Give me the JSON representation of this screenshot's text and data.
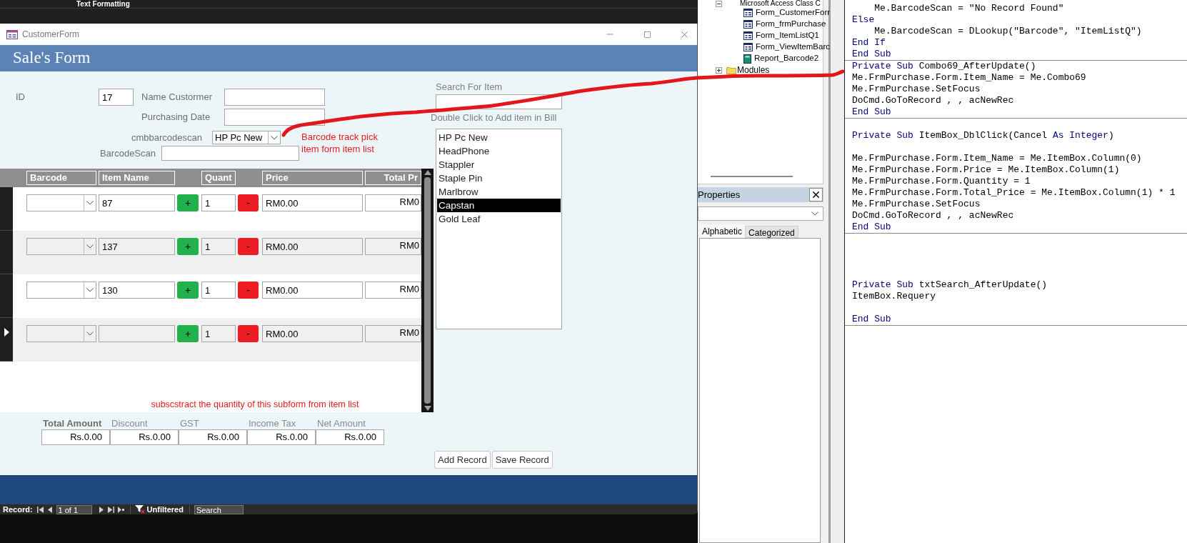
{
  "background": {
    "toolbar_label": "Text Formatting"
  },
  "form": {
    "title": "CustomerForm",
    "heading": "Sale's Form",
    "id": {
      "label": "ID",
      "value": "17"
    },
    "name_customer": {
      "label": "Name Custormer"
    },
    "purchasing_date": {
      "label": "Purchasing Date"
    },
    "barcode_combo": {
      "label": "cmbbarcodescan",
      "value": "HP Pc New"
    },
    "barcode_scan": {
      "label": "BarcodeScan"
    },
    "note_barcode": [
      "Barcode track pick",
      "item form item list"
    ],
    "search": {
      "label": "Search For Item"
    },
    "item_list": {
      "label": "Double Click to Add item in Bill",
      "items": [
        {
          "text": "HP Pc New",
          "selected": false
        },
        {
          "text": "HeadPhone",
          "selected": false
        },
        {
          "text": "Stappler",
          "selected": false
        },
        {
          "text": "Staple Pin",
          "selected": false
        },
        {
          "text": "Marlbrow",
          "selected": false
        },
        {
          "text": "Capstan",
          "selected": true
        },
        {
          "text": "Gold Leaf",
          "selected": false
        }
      ]
    },
    "subform": {
      "columns": [
        "Barcode",
        "Item Name",
        "Quant",
        "Price",
        "Total Pr"
      ],
      "rows": [
        {
          "item_name": "87",
          "add": "+",
          "quantity": "1",
          "remove": "-",
          "price": "RM0.00",
          "total": "RM0",
          "current": false
        },
        {
          "item_name": "137",
          "add": "+",
          "quantity": "1",
          "remove": "-",
          "price": "RM0.00",
          "total": "RM0",
          "current": false
        },
        {
          "item_name": "130",
          "add": "+",
          "quantity": "1",
          "remove": "-",
          "price": "RM0.00",
          "total": "RM0",
          "current": false
        },
        {
          "add": "+",
          "quantity": "1",
          "remove": "-",
          "price": "RM0.00",
          "total": "RM0",
          "current": true
        }
      ],
      "note": "subscstract the quantity of this subform from item list"
    },
    "totals": [
      {
        "label": "Total Amount",
        "value": "Rs.0.00"
      },
      {
        "label": "Discount",
        "value": "Rs.0.00"
      },
      {
        "label": "GST",
        "value": "Rs.0.00"
      },
      {
        "label": "Income Tax",
        "value": "Rs.0.00"
      },
      {
        "label": "Net Amount",
        "value": "Rs.0.00"
      }
    ],
    "buttons": [
      "Add Record",
      "Save Record"
    ],
    "navigation": {
      "label": "Record:",
      "position": "1 of 1",
      "filter": "Unfiltered",
      "search": "Search"
    }
  },
  "project_tree": {
    "items": [
      {
        "name": "Microsoft Access Class C",
        "expanded": true,
        "children": [
          {
            "name": "Form_CustomerForr",
            "kind": "form"
          },
          {
            "name": "Form_frmPurchase",
            "kind": "form"
          },
          {
            "name": "Form_ItemListQ1",
            "kind": "form"
          },
          {
            "name": "Form_ViewItemBarc",
            "kind": "form"
          },
          {
            "name": "Report_Barcode2",
            "kind": "report"
          }
        ]
      },
      {
        "name": "Modules",
        "expanded": false
      }
    ]
  },
  "properties": {
    "title": "Properties",
    "tabs": [
      {
        "label": "Alphabetic",
        "selected": true
      },
      {
        "label": "Categorized",
        "selected": false
      }
    ]
  },
  "code": {
    "procedures": [
      {
        "lines": [
          {
            "kind": "code",
            "tokens": [
              {
                "text": "    Me.BarcodeScan = \"No Record Found\"",
                "keyword": false
              }
            ]
          },
          {
            "kind": "code",
            "tokens": [
              {
                "text": "Else",
                "keyword": true
              }
            ]
          },
          {
            "kind": "code",
            "tokens": [
              {
                "text": "    Me.BarcodeScan = DLookup(\"Barcode\", \"ItemListQ\")",
                "keyword": false
              }
            ]
          },
          {
            "kind": "code",
            "tokens": [
              {
                "text": "End If",
                "keyword": true
              }
            ]
          },
          {
            "kind": "code",
            "tokens": [
              {
                "text": "End Sub",
                "keyword": true
              }
            ]
          }
        ]
      },
      {
        "lines": [
          {
            "kind": "code",
            "tokens": [
              {
                "text": "Private Sub",
                "keyword": true
              },
              {
                "text": " Combo69_AfterUpdate()",
                "keyword": false
              }
            ]
          },
          {
            "kind": "code",
            "tokens": [
              {
                "text": "Me.FrmPurchase.Form.Item_Name = Me.Combo69",
                "keyword": false
              }
            ]
          },
          {
            "kind": "code",
            "tokens": [
              {
                "text": "Me.FrmPurchase.SetFocus",
                "keyword": false
              }
            ]
          },
          {
            "kind": "code",
            "tokens": [
              {
                "text": "DoCmd.GoToRecord , , acNewRec",
                "keyword": false
              }
            ]
          },
          {
            "kind": "code",
            "tokens": [
              {
                "text": "End Sub",
                "keyword": true
              }
            ]
          }
        ]
      },
      {
        "lines": [
          {
            "kind": "blank"
          },
          {
            "kind": "code",
            "tokens": [
              {
                "text": "Private Sub",
                "keyword": true
              },
              {
                "text": " ItemBox_DblClick(Cancel ",
                "keyword": false
              },
              {
                "text": "As Integer",
                "keyword": true
              },
              {
                "text": ")",
                "keyword": false
              }
            ]
          },
          {
            "kind": "blank"
          },
          {
            "kind": "code",
            "tokens": [
              {
                "text": "Me.FrmPurchase.Form.Item_Name = Me.ItemBox.Column(0)",
                "keyword": false
              }
            ]
          },
          {
            "kind": "code",
            "tokens": [
              {
                "text": "Me.FrmPurchase.Form.Price = Me.ItemBox.Column(1)",
                "keyword": false
              }
            ]
          },
          {
            "kind": "code",
            "tokens": [
              {
                "text": "Me.FrmPurchase.Form.Quantity = 1",
                "keyword": false
              }
            ]
          },
          {
            "kind": "code",
            "tokens": [
              {
                "text": "Me.FrmPurchase.Form.Total_Price = Me.ItemBox.Column(1) * 1",
                "keyword": false
              }
            ]
          },
          {
            "kind": "code",
            "tokens": [
              {
                "text": "Me.FrmPurchase.SetFocus",
                "keyword": false
              }
            ]
          },
          {
            "kind": "code",
            "tokens": [
              {
                "text": "DoCmd.GoToRecord , , acNewRec",
                "keyword": false
              }
            ]
          },
          {
            "kind": "code",
            "tokens": [
              {
                "text": "End Sub",
                "keyword": true
              }
            ]
          }
        ]
      },
      {
        "lines": [
          {
            "kind": "blank"
          },
          {
            "kind": "blank"
          },
          {
            "kind": "blank"
          },
          {
            "kind": "blank"
          },
          {
            "kind": "code",
            "tokens": [
              {
                "text": "Private Sub",
                "keyword": true
              },
              {
                "text": " txtSearch_AfterUpdate()",
                "keyword": false
              }
            ]
          },
          {
            "kind": "code",
            "tokens": [
              {
                "text": "ItemBox.Requery",
                "keyword": false
              }
            ]
          },
          {
            "kind": "blank"
          },
          {
            "kind": "code",
            "tokens": [
              {
                "text": "End Sub",
                "keyword": true
              }
            ]
          }
        ]
      }
    ]
  }
}
